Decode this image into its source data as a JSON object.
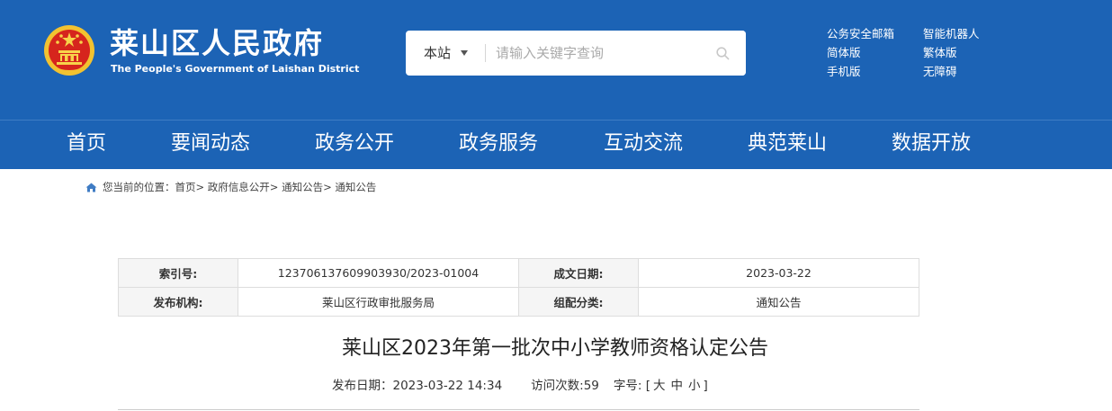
{
  "header": {
    "title": "莱山区人民政府",
    "subtitle": "The People's Government of Laishan District",
    "emblem_icon": "national-emblem-icon",
    "background_color": "#1c63b5"
  },
  "search": {
    "scope": "本站",
    "placeholder": "请输入关键字查询",
    "value": "",
    "button_icon": "search-icon"
  },
  "quick_links": [
    "公务安全邮箱",
    "智能机器人",
    "简体版",
    "繁体版",
    "手机版",
    "无障碍"
  ],
  "nav": {
    "items": [
      "首页",
      "要闻动态",
      "政务公开",
      "政务服务",
      "互动交流",
      "典范莱山",
      "数据开放"
    ]
  },
  "breadcrumb": {
    "icon": "home-icon",
    "prefix": "您当前的位置：",
    "items": [
      "首页",
      "政府信息公开",
      "通知公告",
      "通知公告"
    ],
    "separator": ">"
  },
  "meta": {
    "index_label": "索引号:",
    "index_value": "123706137609903930/2023-01004",
    "date_label": "成文日期:",
    "date_value": "2023-03-22",
    "org_label": "发布机构:",
    "org_value": "莱山区行政审批服务局",
    "category_label": "组配分类:",
    "category_value": "通知公告"
  },
  "article": {
    "title": "莱山区2023年第一批次中小学教师资格认定公告",
    "publish_label": "发布日期：",
    "publish_date": "2023-03-22 14:34",
    "visits_label": "访问次数:",
    "visits": "59",
    "font_label": "字号:",
    "font_open": "[",
    "font_sizes": [
      "大",
      "中",
      "小"
    ],
    "font_close": "]"
  }
}
